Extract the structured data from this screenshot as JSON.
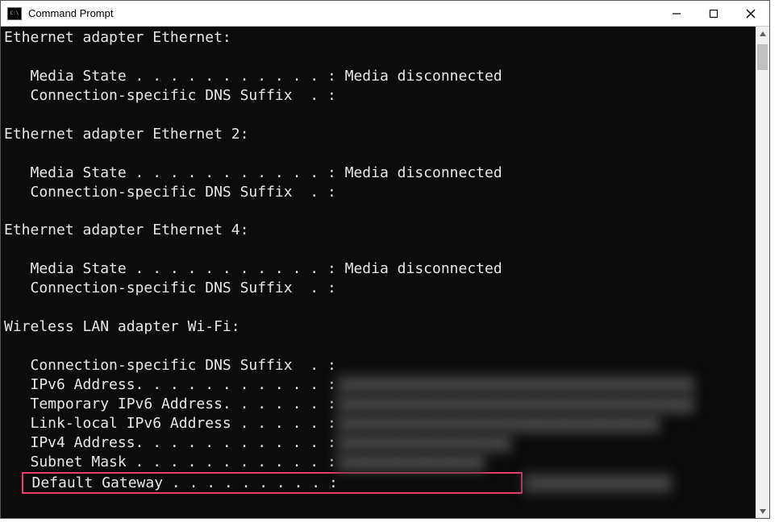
{
  "window": {
    "title": "Command Prompt",
    "icon_label": "C:\\"
  },
  "adapters": [
    {
      "header": "Ethernet adapter Ethernet:",
      "lines": [
        {
          "label": "Media State . . . . . . . . . . . :",
          "value": " Media disconnected"
        },
        {
          "label": "Connection-specific DNS Suffix  . :",
          "value": ""
        }
      ]
    },
    {
      "header": "Ethernet adapter Ethernet 2:",
      "lines": [
        {
          "label": "Media State . . . . . . . . . . . :",
          "value": " Media disconnected"
        },
        {
          "label": "Connection-specific DNS Suffix  . :",
          "value": ""
        }
      ]
    },
    {
      "header": "Ethernet adapter Ethernet 4:",
      "lines": [
        {
          "label": "Media State . . . . . . . . . . . :",
          "value": " Media disconnected"
        },
        {
          "label": "Connection-specific DNS Suffix  . :",
          "value": ""
        }
      ]
    }
  ],
  "wifi": {
    "header": "Wireless LAN adapter Wi-Fi:",
    "lines": [
      {
        "label": "Connection-specific DNS Suffix  . :",
        "value": "",
        "blurred": false
      },
      {
        "label": "IPv6 Address. . . . . . . . . . . :",
        "value": " xxxxxxxxxxxxxxxxxxxxxxxxxxxxxxxxxxxxxxxx",
        "blurred": true
      },
      {
        "label": "Temporary IPv6 Address. . . . . . :",
        "value": " xxxxxxxxxxxxxxxxxxxxxxxxxxxxxxxxxxxxxxxx",
        "blurred": true
      },
      {
        "label": "Link-local IPv6 Address . . . . . :",
        "value": " xxxxxxxxxxxxxxxxxxxxxxxxxxxxxxxxxxxx",
        "blurred": true
      },
      {
        "label": "IPv4 Address. . . . . . . . . . . :",
        "value": " xxxxxxxxxxxxxxxxxxx",
        "blurred": true
      },
      {
        "label": "Subnet Mask . . . . . . . . . . . :",
        "value": " xxxxxxxxxxxxxxxx",
        "blurred": true
      }
    ],
    "highlighted": {
      "label": "Default Gateway . . . . . . . . . :",
      "value": " xxxxxxxxxxxxxxxx"
    }
  }
}
